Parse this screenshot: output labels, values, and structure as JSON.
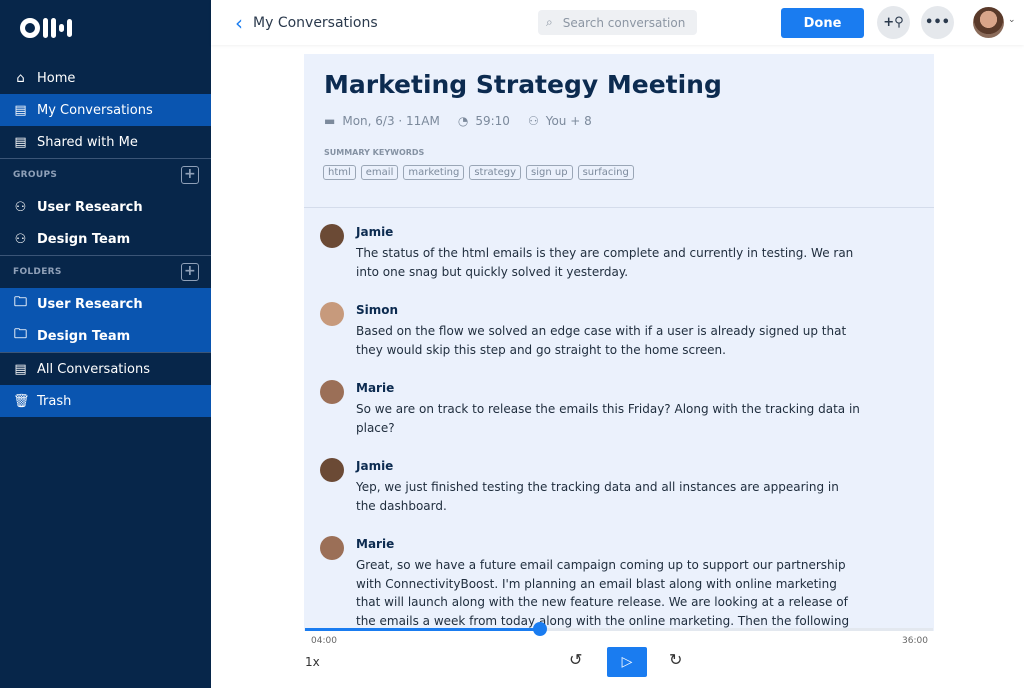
{
  "sidebar": {
    "items": [
      {
        "label": "Home",
        "icon": "home-icon"
      },
      {
        "label": "My Conversations",
        "icon": "document-icon",
        "selected": true
      },
      {
        "label": "Shared with Me",
        "icon": "shared-document-icon"
      }
    ],
    "groups_label": "GROUPS",
    "groups": [
      {
        "label": "User Research"
      },
      {
        "label": "Design Team"
      }
    ],
    "folders_label": "FOLDERS",
    "folders": [
      {
        "label": "User Research"
      },
      {
        "label": "Design Team"
      }
    ],
    "bottom": [
      {
        "label": "All Conversations"
      },
      {
        "label": "Trash"
      }
    ]
  },
  "header": {
    "back_label": "My Conversations",
    "search_placeholder": "Search conversation",
    "done_label": "Done",
    "more": "•••"
  },
  "conversation": {
    "title": "Marketing Strategy Meeting",
    "date": "Mon, 6/3 · 11AM",
    "duration": "59:10",
    "participants": "You + 8",
    "keywords_label": "SUMMARY KEYWORDS",
    "keywords": [
      "html",
      "email",
      "marketing",
      "strategy",
      "sign up",
      "surfacing"
    ]
  },
  "messages": [
    {
      "speaker": "Jamie",
      "text": "The status of the html emails is they are complete and currently in testing. We ran into one snag but quickly solved it yesterday."
    },
    {
      "speaker": "Simon",
      "text": "Based on the flow we solved an edge case with if a user is already signed up that they would skip this step and go straight to the home screen."
    },
    {
      "speaker": "Marie",
      "text": "So we are on track to release the emails this Friday? Along with the tracking data in place?"
    },
    {
      "speaker": "Jamie",
      "text": "Yep, we just finished testing the tracking data and all instances are appearing in the dashboard."
    },
    {
      "speaker": "Marie",
      "text": "Great, so we have a future email campaign coming up to support our partnership with ConnectivityBoost. I'm planning an email blast along with online marketing that will launch along with the new feature release. We are looking at a release of the emails a week from today along with the online marketing. Then the following week the new"
    }
  ],
  "player": {
    "current": "04:00",
    "total": "36:00",
    "progress": 0.374,
    "speed": "1x",
    "accent": "#1a7cf0"
  }
}
